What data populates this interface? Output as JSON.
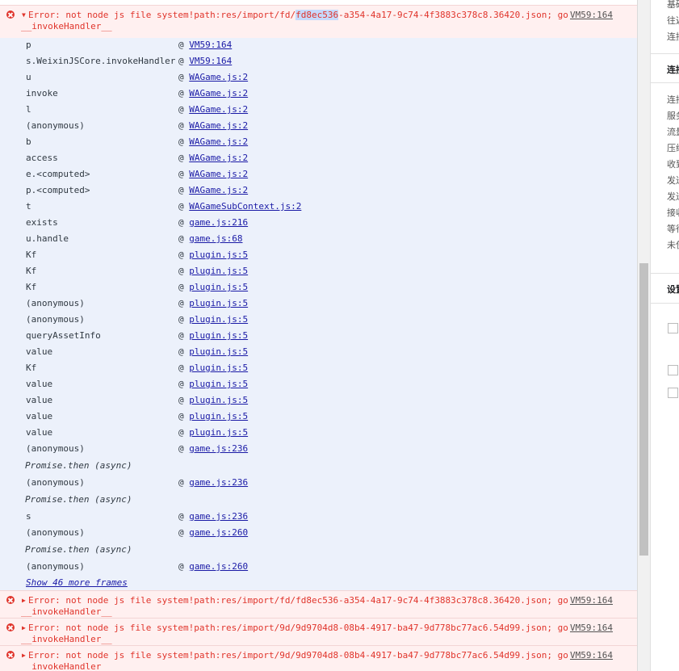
{
  "error_main": {
    "prefix": "Error: not node js file system!path:res/import/fd/",
    "highlight": "fd8ec536",
    "suffix": "-a354-4a17-9c74-4f3883c378c8.36420.json; go",
    "handler": "__invokeHandler__",
    "source": "VM59:164"
  },
  "stack": [
    {
      "fn": "p",
      "src": "VM59:164"
    },
    {
      "fn": "s.WeixinJSCore.invokeHandler",
      "src": "VM59:164"
    },
    {
      "fn": "u",
      "src": "WAGame.js:2"
    },
    {
      "fn": "invoke",
      "src": "WAGame.js:2"
    },
    {
      "fn": "l",
      "src": "WAGame.js:2"
    },
    {
      "fn": "(anonymous)",
      "src": "WAGame.js:2"
    },
    {
      "fn": "b",
      "src": "WAGame.js:2"
    },
    {
      "fn": "access",
      "src": "WAGame.js:2"
    },
    {
      "fn": "e.<computed>",
      "src": "WAGame.js:2"
    },
    {
      "fn": "p.<computed>",
      "src": "WAGame.js:2"
    },
    {
      "fn": "t",
      "src": "WAGameSubContext.js:2"
    },
    {
      "fn": "exists",
      "src": "game.js:216"
    },
    {
      "fn": "u.handle",
      "src": "game.js:68"
    },
    {
      "fn": "Kf",
      "src": "plugin.js:5"
    },
    {
      "fn": "Kf",
      "src": "plugin.js:5"
    },
    {
      "fn": "Kf",
      "src": "plugin.js:5"
    },
    {
      "fn": "(anonymous)",
      "src": "plugin.js:5"
    },
    {
      "fn": "(anonymous)",
      "src": "plugin.js:5"
    },
    {
      "fn": "queryAssetInfo",
      "src": "plugin.js:5"
    },
    {
      "fn": "value",
      "src": "plugin.js:5"
    },
    {
      "fn": "Kf",
      "src": "plugin.js:5"
    },
    {
      "fn": "value",
      "src": "plugin.js:5"
    },
    {
      "fn": "value",
      "src": "plugin.js:5"
    },
    {
      "fn": "value",
      "src": "plugin.js:5"
    },
    {
      "fn": "value",
      "src": "plugin.js:5"
    },
    {
      "fn": "(anonymous)",
      "src": "game.js:236"
    }
  ],
  "async_groups": [
    {
      "label": "Promise.then (async)",
      "frames": [
        {
          "fn": "(anonymous)",
          "src": "game.js:236"
        }
      ]
    },
    {
      "label": "Promise.then (async)",
      "frames": [
        {
          "fn": "s",
          "src": "game.js:236"
        },
        {
          "fn": "(anonymous)",
          "src": "game.js:260"
        }
      ]
    },
    {
      "label": "Promise.then (async)",
      "frames": [
        {
          "fn": "(anonymous)",
          "src": "game.js:260"
        }
      ]
    }
  ],
  "at_symbol": "@",
  "show_more": "Show 46 more frames",
  "collapsed_errors": [
    {
      "message": "Error: not node js file system!path:res/import/fd/fd8ec536-a354-4a17-9c74-4f3883c378c8.36420.json; go",
      "handler": "__invokeHandler__",
      "source": "VM59:164"
    },
    {
      "message": "Error: not node js file system!path:res/import/9d/9d9704d8-08b4-4917-ba47-9d778bc77ac6.54d99.json; go",
      "handler": "__invokeHandler__",
      "source": "VM59:164"
    },
    {
      "message": "Error: not node js file system!path:res/import/9d/9d9704d8-08b4-4917-ba47-9d778bc77ac6.54d99.json; go",
      "handler": "__invokeHandler__",
      "source": "VM59:164"
    }
  ],
  "side_panel": {
    "top_items": [
      "基础",
      "往返",
      "连接"
    ],
    "section1_title": "连接",
    "section1_items": [
      "连接",
      "服务",
      "流量",
      "压缩",
      "收到",
      "发送",
      "发送",
      "接收",
      "等待",
      "未使"
    ],
    "section2_title": "设置",
    "checkbox_count": 3
  },
  "colors": {
    "error_red": "#e0342b",
    "error_bg": "#fff0f0",
    "stack_bg": "#ecf1fb",
    "link": "#1a1aa6",
    "highlight": "#c6dafc"
  }
}
